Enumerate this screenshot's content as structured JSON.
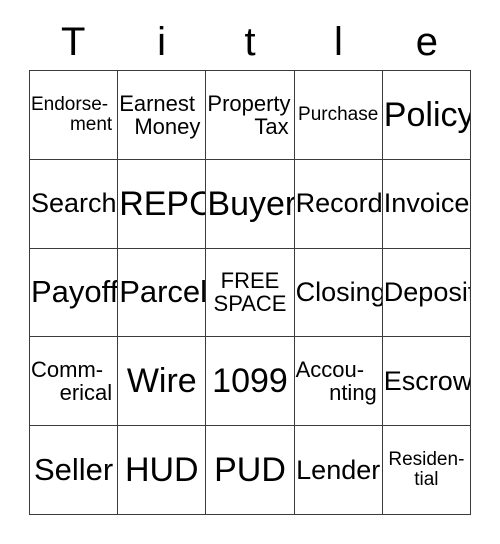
{
  "card": {
    "title": "Title",
    "title_letters": [
      "T",
      "i",
      "t",
      "l",
      "e"
    ],
    "columns": 5,
    "rows": 5,
    "colors": {
      "background": "#ffffff",
      "text": "#000000",
      "grid_line": "#3b3b3b"
    },
    "cells": [
      {
        "id": "r1c1",
        "text": "Endorsement",
        "line1": "Endorse-",
        "line2": "ment",
        "lines": 2,
        "size": "xs",
        "align": "wrap-just",
        "free": false
      },
      {
        "id": "r1c2",
        "text": "Earnest Money",
        "line1": "Earnest",
        "line2": "Money",
        "lines": 2,
        "size": "sm",
        "align": "wrap-just",
        "free": false
      },
      {
        "id": "r1c3",
        "text": "Property Tax",
        "line1": "Property",
        "line2": "Tax",
        "lines": 2,
        "size": "sm",
        "align": "wrap-just",
        "free": false
      },
      {
        "id": "r1c4",
        "text": "Purchase",
        "line1": "Purchase",
        "line2": "",
        "lines": 1,
        "size": "xs",
        "align": "wrap-center",
        "free": false
      },
      {
        "id": "r1c5",
        "text": "Policy",
        "line1": "Policy",
        "line2": "",
        "lines": 1,
        "size": "xl",
        "align": "wrap-center",
        "free": false
      },
      {
        "id": "r2c1",
        "text": "Search",
        "line1": "Search",
        "line2": "",
        "lines": 1,
        "size": "md",
        "align": "wrap-center",
        "free": false
      },
      {
        "id": "r2c2",
        "text": "REPC",
        "line1": "REPC",
        "line2": "",
        "lines": 1,
        "size": "xl",
        "align": "wrap-center",
        "free": false
      },
      {
        "id": "r2c3",
        "text": "Buyer",
        "line1": "Buyer",
        "line2": "",
        "lines": 1,
        "size": "xl",
        "align": "wrap-center",
        "free": false
      },
      {
        "id": "r2c4",
        "text": "Record",
        "line1": "Record",
        "line2": "",
        "lines": 1,
        "size": "md",
        "align": "wrap-center",
        "free": false
      },
      {
        "id": "r2c5",
        "text": "Invoice",
        "line1": "Invoice",
        "line2": "",
        "lines": 1,
        "size": "md",
        "align": "wrap-center",
        "free": false
      },
      {
        "id": "r3c1",
        "text": "Payoff",
        "line1": "Payoff",
        "line2": "",
        "lines": 1,
        "size": "lg",
        "align": "wrap-center",
        "free": false
      },
      {
        "id": "r3c2",
        "text": "Parcel",
        "line1": "Parcel",
        "line2": "",
        "lines": 1,
        "size": "lg",
        "align": "wrap-center",
        "free": false
      },
      {
        "id": "r3c3",
        "text": "FREE SPACE",
        "line1": "FREE",
        "line2": "SPACE",
        "lines": 2,
        "size": "sm",
        "align": "wrap-center",
        "free": true
      },
      {
        "id": "r3c4",
        "text": "Closing",
        "line1": "Closing",
        "line2": "",
        "lines": 1,
        "size": "md",
        "align": "wrap-center",
        "free": false
      },
      {
        "id": "r3c5",
        "text": "Deposit",
        "line1": "Deposit",
        "line2": "",
        "lines": 1,
        "size": "md",
        "align": "wrap-center",
        "free": false
      },
      {
        "id": "r4c1",
        "text": "Commerical",
        "line1": "Comm-",
        "line2": "erical",
        "lines": 2,
        "size": "sm",
        "align": "wrap-just",
        "free": false
      },
      {
        "id": "r4c2",
        "text": "Wire",
        "line1": "Wire",
        "line2": "",
        "lines": 1,
        "size": "xl",
        "align": "wrap-center",
        "free": false
      },
      {
        "id": "r4c3",
        "text": "1099",
        "line1": "1099",
        "line2": "",
        "lines": 1,
        "size": "xl",
        "align": "wrap-center",
        "free": false
      },
      {
        "id": "r4c4",
        "text": "Accounting",
        "line1": "Accou-",
        "line2": "nting",
        "lines": 2,
        "size": "sm",
        "align": "wrap-just",
        "free": false
      },
      {
        "id": "r4c5",
        "text": "Escrow",
        "line1": "Escrow",
        "line2": "",
        "lines": 1,
        "size": "md",
        "align": "wrap-center",
        "free": false
      },
      {
        "id": "r5c1",
        "text": "Seller",
        "line1": "Seller",
        "line2": "",
        "lines": 1,
        "size": "lg",
        "align": "wrap-center",
        "free": false
      },
      {
        "id": "r5c2",
        "text": "HUD",
        "line1": "HUD",
        "line2": "",
        "lines": 1,
        "size": "xl",
        "align": "wrap-center",
        "free": false
      },
      {
        "id": "r5c3",
        "text": "PUD",
        "line1": "PUD",
        "line2": "",
        "lines": 1,
        "size": "xl",
        "align": "wrap-center",
        "free": false
      },
      {
        "id": "r5c4",
        "text": "Lender",
        "line1": "Lender",
        "line2": "",
        "lines": 1,
        "size": "md",
        "align": "wrap-center",
        "free": false
      },
      {
        "id": "r5c5",
        "text": "Residential",
        "line1": "Residen-",
        "line2": "tial",
        "lines": 2,
        "size": "xs",
        "align": "wrap-center",
        "free": false
      }
    ]
  }
}
